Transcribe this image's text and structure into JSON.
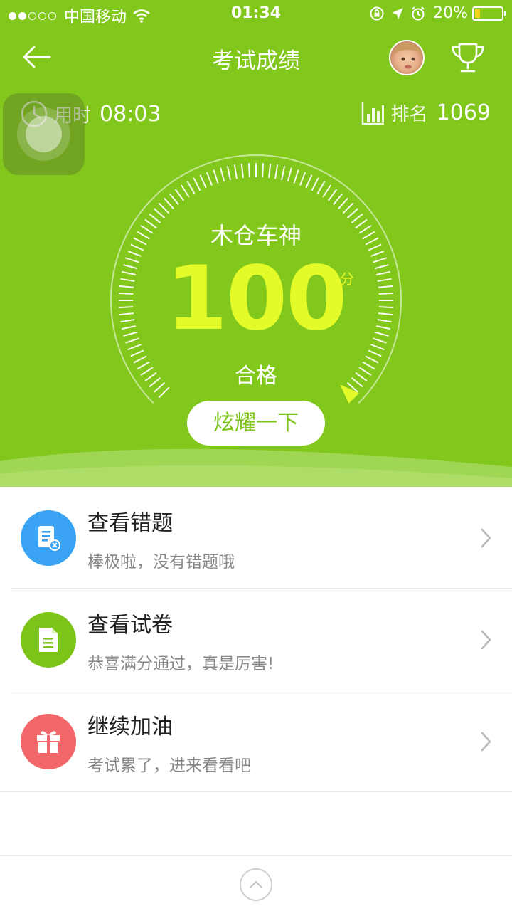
{
  "status_bar": {
    "carrier": "中国移动",
    "time": "01:34",
    "battery": "20%",
    "battery_level": 0.2,
    "signal_bars": 2,
    "signal_total": 5
  },
  "nav": {
    "title": "考试成绩"
  },
  "stats": {
    "time_label": "用时",
    "time_value": "08:03",
    "rank_label": "排名",
    "rank_value": "1069"
  },
  "result": {
    "rank_title": "木仓车神",
    "score": "100",
    "unit": "分",
    "status": "合格",
    "share_label": "炫耀一下",
    "gauge_fraction": 1.0
  },
  "actions": [
    {
      "title": "查看错题",
      "subtitle": "棒极啦，没有错题哦",
      "color": "#3aa3f4",
      "icon": "wrong-questions-icon"
    },
    {
      "title": "查看试卷",
      "subtitle": "恭喜满分通过，真是厉害!",
      "color": "#7cc31a",
      "icon": "document-icon"
    },
    {
      "title": "继续加油",
      "subtitle": "考试累了，进来看看吧",
      "color": "#f2676a",
      "icon": "gift-icon"
    }
  ],
  "colors": {
    "brand_green": "#82c81c",
    "score_yellow": "#e4fb2a"
  }
}
